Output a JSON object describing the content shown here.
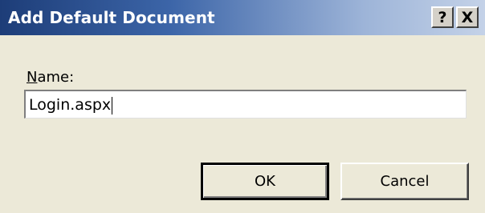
{
  "window": {
    "title": "Add Default Document",
    "help_glyph": "?",
    "close_glyph": "X"
  },
  "form": {
    "name_label_accel": "N",
    "name_label_rest": "ame:",
    "name_value": "Login.aspx"
  },
  "buttons": {
    "ok_label": "OK",
    "cancel_label": "Cancel"
  },
  "colors": {
    "titlebar_start": "#1d3d78",
    "titlebar_end": "#c4d2e8",
    "dialog_bg": "#ece9d8"
  },
  "icons": [
    "help-icon",
    "close-icon"
  ]
}
